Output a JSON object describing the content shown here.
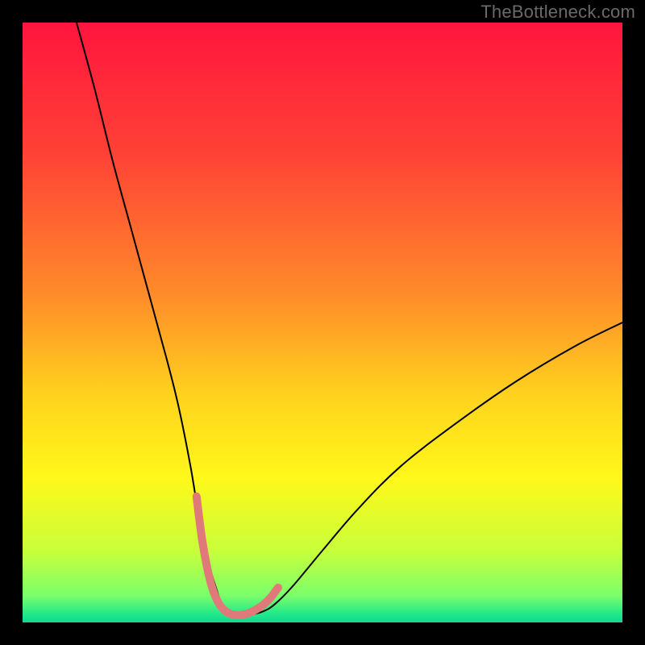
{
  "watermark": "TheBottleneck.com",
  "chart_data": {
    "type": "line",
    "title": "",
    "xlabel": "",
    "ylabel": "",
    "xlim": [
      0,
      100
    ],
    "ylim": [
      0,
      100
    ],
    "background": {
      "type": "vertical-gradient",
      "stops": [
        {
          "pos": 0.0,
          "color": "#ff153e"
        },
        {
          "pos": 0.22,
          "color": "#ff4236"
        },
        {
          "pos": 0.45,
          "color": "#ff8a2a"
        },
        {
          "pos": 0.62,
          "color": "#ffd21e"
        },
        {
          "pos": 0.76,
          "color": "#fff81a"
        },
        {
          "pos": 0.88,
          "color": "#c8ff3a"
        },
        {
          "pos": 0.955,
          "color": "#7cff6a"
        },
        {
          "pos": 0.985,
          "color": "#24e989"
        },
        {
          "pos": 1.0,
          "color": "#11d991"
        }
      ]
    },
    "series": [
      {
        "name": "bottleneck-curve",
        "stroke": "#000000",
        "stroke_width": 2,
        "x": [
          9,
          12,
          15,
          18,
          21,
          24,
          26,
          28,
          29.5,
          31,
          32.5,
          33.5,
          34.5,
          36,
          38,
          40,
          42,
          45,
          50,
          56,
          63,
          72,
          82,
          92,
          100
        ],
        "values": [
          100,
          89,
          77,
          66,
          55,
          44,
          36,
          26,
          17,
          10,
          5,
          2.2,
          1.4,
          1.2,
          1.3,
          1.8,
          3.0,
          6,
          12,
          19,
          26,
          33,
          40,
          46,
          50
        ]
      },
      {
        "name": "valley-highlight",
        "stroke": "#e07a7a",
        "stroke_width": 10,
        "stroke_linecap": "round",
        "x": [
          29,
          29.9,
          30.8,
          31.7,
          32.7,
          33.7,
          34.7,
          35.8,
          36.8,
          37.8,
          39.0,
          40.2,
          41.4,
          42.6
        ],
        "values": [
          21,
          14,
          9,
          5.5,
          3.2,
          2.0,
          1.4,
          1.2,
          1.3,
          1.6,
          2.2,
          3.0,
          4.2,
          5.8
        ]
      }
    ],
    "grid": false,
    "legend": {
      "visible": false
    }
  }
}
